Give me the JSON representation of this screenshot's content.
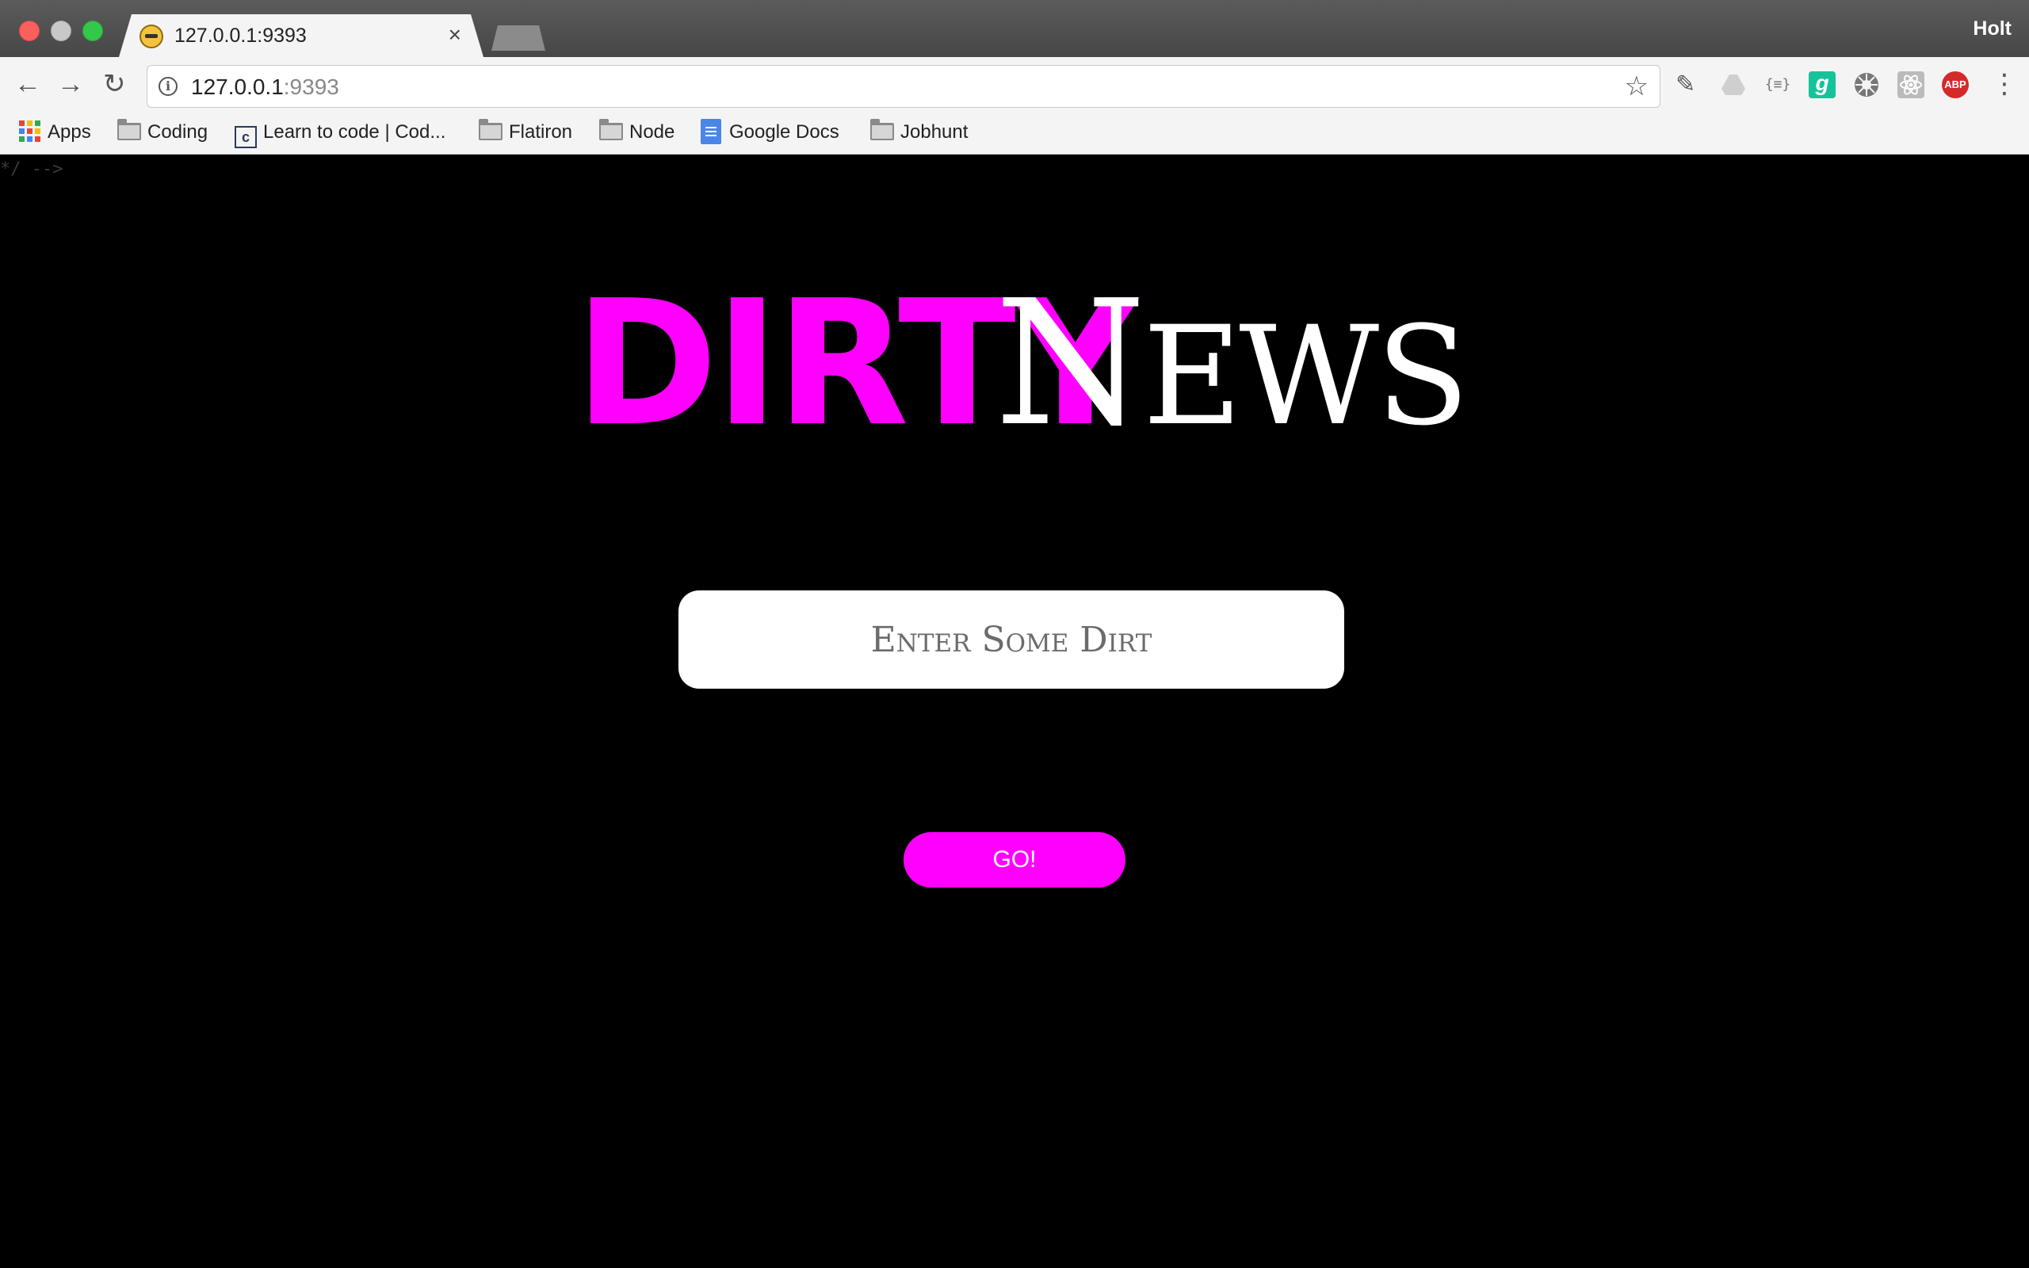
{
  "window": {
    "profile_name": "Holt"
  },
  "tabs": [
    {
      "title": "127.0.0.1:9393",
      "favicon": "laughing-emoji-icon"
    }
  ],
  "toolbar": {
    "url_host": "127.0.0.1",
    "url_port": ":9393",
    "extensions": [
      "eyedropper-icon",
      "google-drive-icon",
      "json-formatter-icon",
      "grammarly-icon",
      "settings-wheel-icon",
      "react-devtools-icon",
      "adblock-plus-icon"
    ],
    "adblock_label": "ABP",
    "json_label": "{≡}",
    "grammarly_label": "g"
  },
  "bookmarks": [
    {
      "label": "Apps",
      "icon": "apps-grid-icon"
    },
    {
      "label": "Coding",
      "icon": "folder-icon"
    },
    {
      "label": "Learn to code | Cod...",
      "icon": "codecademy-icon",
      "icon_text": "c"
    },
    {
      "label": "Flatiron",
      "icon": "folder-icon"
    },
    {
      "label": "Node",
      "icon": "folder-icon"
    },
    {
      "label": "Google Docs",
      "icon": "google-docs-icon"
    },
    {
      "label": "Jobhunt",
      "icon": "folder-icon"
    }
  ],
  "page": {
    "stray_comment": "*/ -->",
    "logo": {
      "first_word": "DIRTY",
      "second_word_initial": "N",
      "second_word_rest": "EWS"
    },
    "input_placeholder": "Enter Some Dirt",
    "go_button_label": "GO!",
    "colors": {
      "accent": "#ff00ff",
      "background": "#000000",
      "logo_secondary": "#ffffff"
    }
  }
}
